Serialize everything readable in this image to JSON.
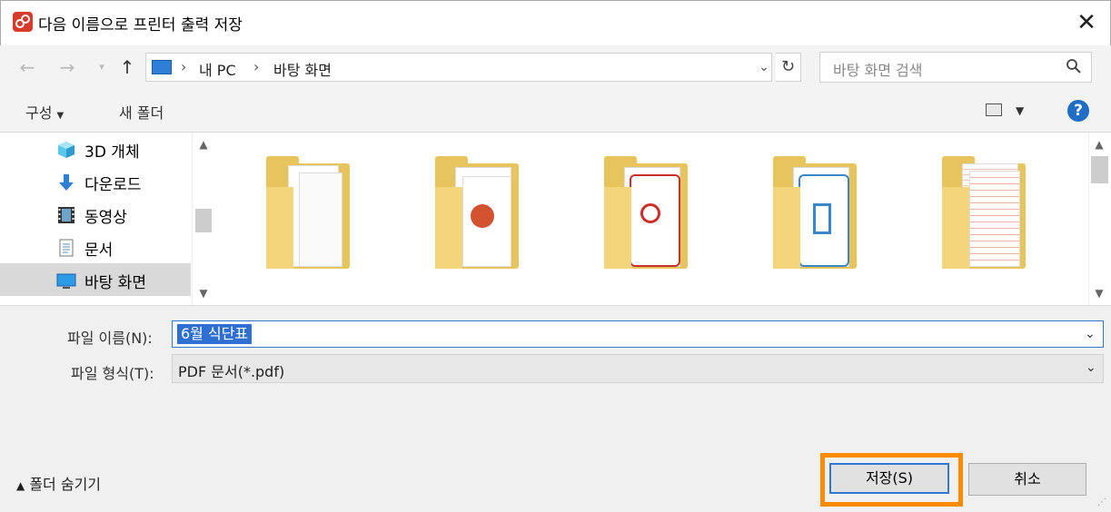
{
  "window": {
    "title": "다음 이름으로 프린터 출력 저장"
  },
  "nav": {
    "breadcrumb": [
      "내 PC",
      "바탕 화면"
    ],
    "separator": "›",
    "search_placeholder": "바탕 화면 검색"
  },
  "toolbar": {
    "organize": "구성",
    "new_folder": "새 폴더"
  },
  "sidebar": {
    "items": [
      {
        "label": "3D 개체",
        "icon": "cube-icon"
      },
      {
        "label": "다운로드",
        "icon": "download-icon"
      },
      {
        "label": "동영상",
        "icon": "video-icon"
      },
      {
        "label": "문서",
        "icon": "document-icon"
      },
      {
        "label": "바탕 화면",
        "icon": "desktop-icon",
        "selected": true
      }
    ]
  },
  "folders": [
    {
      "icon": "folder-with-documents-icon"
    },
    {
      "icon": "folder-with-powerpoint-icon"
    },
    {
      "icon": "folder-with-pdf-icon"
    },
    {
      "icon": "folder-with-hangul-icon"
    },
    {
      "icon": "folder-with-table-icon"
    }
  ],
  "form": {
    "filename_label": "파일 이름(N):",
    "filename_value": "6월 식단표",
    "filetype_label": "파일 형식(T):",
    "filetype_value": "PDF 문서(*.pdf)"
  },
  "footer": {
    "hide_folders": "폴더 숨기기",
    "save": "저장(S)",
    "cancel": "취소"
  },
  "colors": {
    "accent": "#2f7ad0",
    "highlight": "#ff8c00",
    "app_icon": "#d93a2e"
  }
}
